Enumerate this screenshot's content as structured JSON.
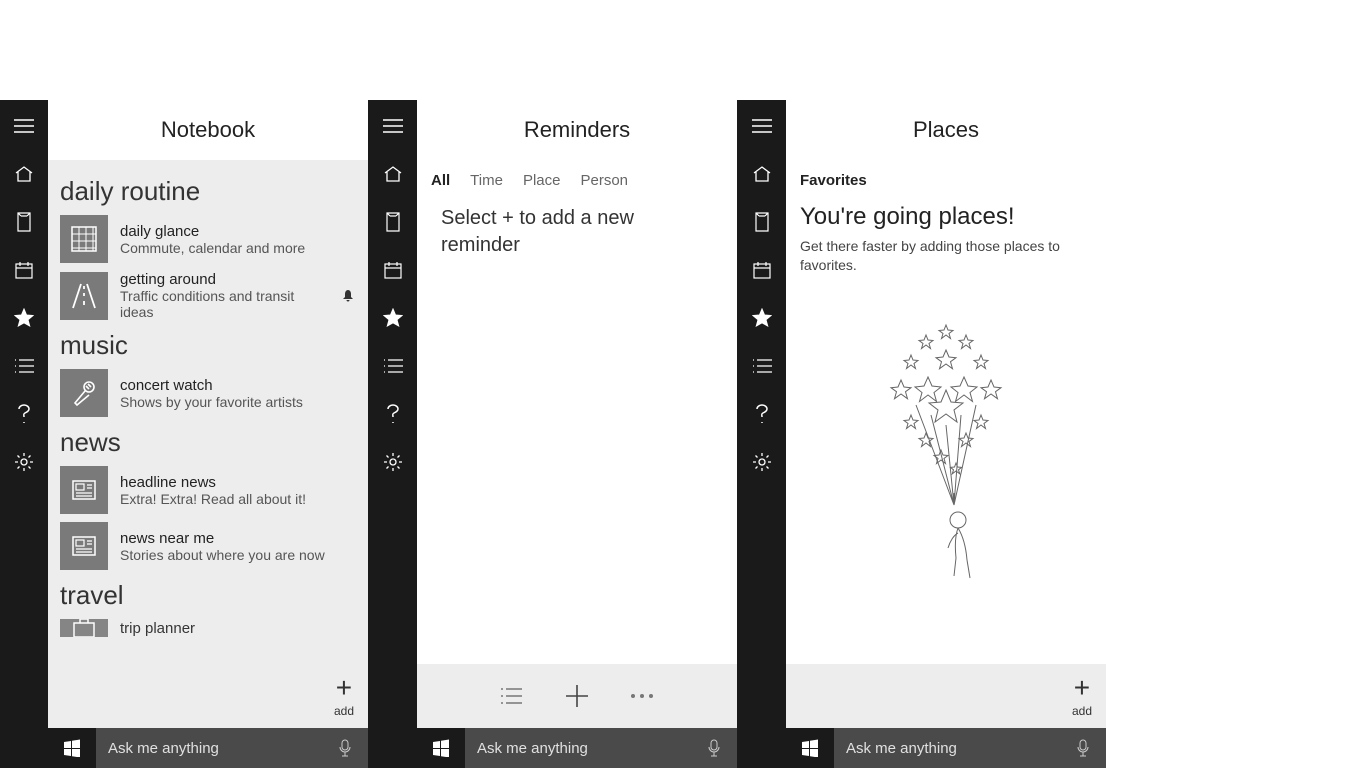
{
  "panes": {
    "notebook": {
      "title": "Notebook",
      "sections": {
        "daily_routine": {
          "head": "daily routine",
          "daily_glance": {
            "title": "daily glance",
            "sub": "Commute, calendar and more"
          },
          "getting_around": {
            "title": "getting around",
            "sub": "Traffic conditions and transit ideas"
          }
        },
        "music": {
          "head": "music",
          "concert_watch": {
            "title": "concert watch",
            "sub": "Shows by your favorite artists"
          }
        },
        "news": {
          "head": "news",
          "headline_news": {
            "title": "headline news",
            "sub": "Extra! Extra! Read all about it!"
          },
          "news_near_me": {
            "title": "news near me",
            "sub": "Stories about where you are now"
          }
        },
        "travel": {
          "head": "travel",
          "trip_planner": {
            "title": "trip planner"
          }
        }
      },
      "add_label": "add"
    },
    "reminders": {
      "title": "Reminders",
      "filters": {
        "all": "All",
        "time": "Time",
        "place": "Place",
        "person": "Person"
      },
      "empty_message": "Select + to add a new reminder"
    },
    "places": {
      "title": "Places",
      "favorites_head": "Favorites",
      "headline": "You're going places!",
      "sub": "Get there faster by adding those places to favorites.",
      "add_label": "add"
    }
  },
  "taskbar": {
    "search_placeholder": "Ask me anything"
  }
}
